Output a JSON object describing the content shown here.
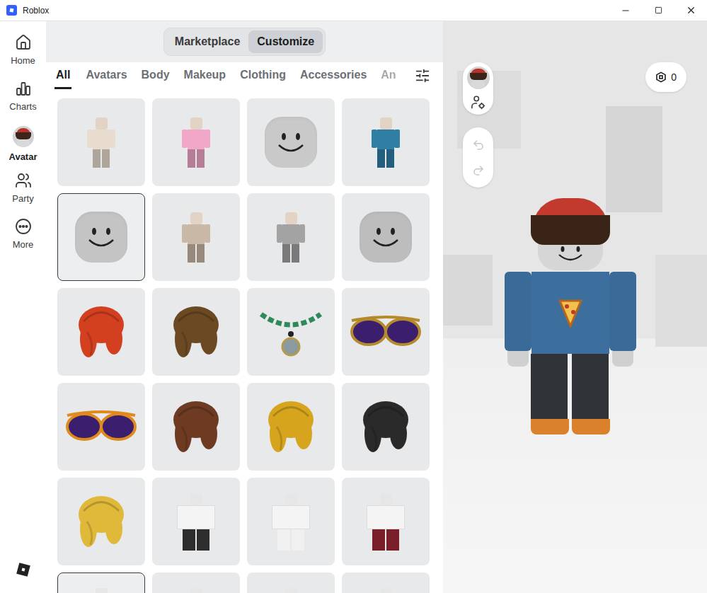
{
  "window": {
    "title": "Roblox"
  },
  "sidebar": {
    "items": [
      {
        "label": "Home",
        "selected": false
      },
      {
        "label": "Charts",
        "selected": false
      },
      {
        "label": "Avatar",
        "selected": true
      },
      {
        "label": "Party",
        "selected": false
      },
      {
        "label": "More",
        "selected": false
      }
    ]
  },
  "mode_switch": [
    {
      "label": "Marketplace",
      "selected": false
    },
    {
      "label": "Customize",
      "selected": true
    }
  ],
  "tabs": [
    {
      "label": "All",
      "selected": true
    },
    {
      "label": "Avatars",
      "selected": false
    },
    {
      "label": "Body",
      "selected": false
    },
    {
      "label": "Makeup",
      "selected": false
    },
    {
      "label": "Clothing",
      "selected": false
    },
    {
      "label": "Accessories",
      "selected": false
    },
    {
      "label": "An",
      "selected": false
    }
  ],
  "items": [
    {
      "kind": "avatar",
      "color": "#e8dccf",
      "selected": false
    },
    {
      "kind": "avatar",
      "color": "#f2a7c8",
      "selected": false
    },
    {
      "kind": "head",
      "color": "#c9c9c9",
      "selected": false
    },
    {
      "kind": "avatar",
      "color": "#2f7fa5",
      "selected": false
    },
    {
      "kind": "head",
      "color": "#c4c4c4",
      "selected": true
    },
    {
      "kind": "avatar",
      "color": "#c9b8a6",
      "selected": false
    },
    {
      "kind": "body",
      "color": "#a3a3a3",
      "selected": false
    },
    {
      "kind": "head",
      "color": "#bdbdbd",
      "selected": false
    },
    {
      "kind": "hair",
      "color": "#d2401f",
      "selected": false
    },
    {
      "kind": "hair",
      "color": "#6b4a23",
      "selected": false
    },
    {
      "kind": "necklace",
      "color": "#2f8a5a",
      "selected": false
    },
    {
      "kind": "glasses",
      "color": "#3b1f6e",
      "selected": false
    },
    {
      "kind": "glasses",
      "color": "#e08a1e",
      "selected": false
    },
    {
      "kind": "hair",
      "color": "#6e3b22",
      "selected": false
    },
    {
      "kind": "hair",
      "color": "#d6a51d",
      "selected": false
    },
    {
      "kind": "hair",
      "color": "#2a2a2a",
      "selected": false
    },
    {
      "kind": "hair",
      "color": "#e0b93a",
      "selected": false
    },
    {
      "kind": "outfit",
      "color": "#2d2d2d",
      "selected": false
    },
    {
      "kind": "outfit",
      "color": "#f0f0f0",
      "selected": false
    },
    {
      "kind": "outfit",
      "color": "#7a1f2a",
      "selected": false
    },
    {
      "kind": "outfit",
      "color": "#d9d9d9",
      "selected": true
    },
    {
      "kind": "outfit",
      "color": "#d9d9d9",
      "selected": false
    },
    {
      "kind": "outfit",
      "color": "#d9d9d9",
      "selected": false
    },
    {
      "kind": "outfit",
      "color": "#d9d9d9",
      "selected": false
    }
  ],
  "history": {
    "can_undo": false,
    "can_redo": false
  },
  "robux": {
    "balance": "0"
  }
}
